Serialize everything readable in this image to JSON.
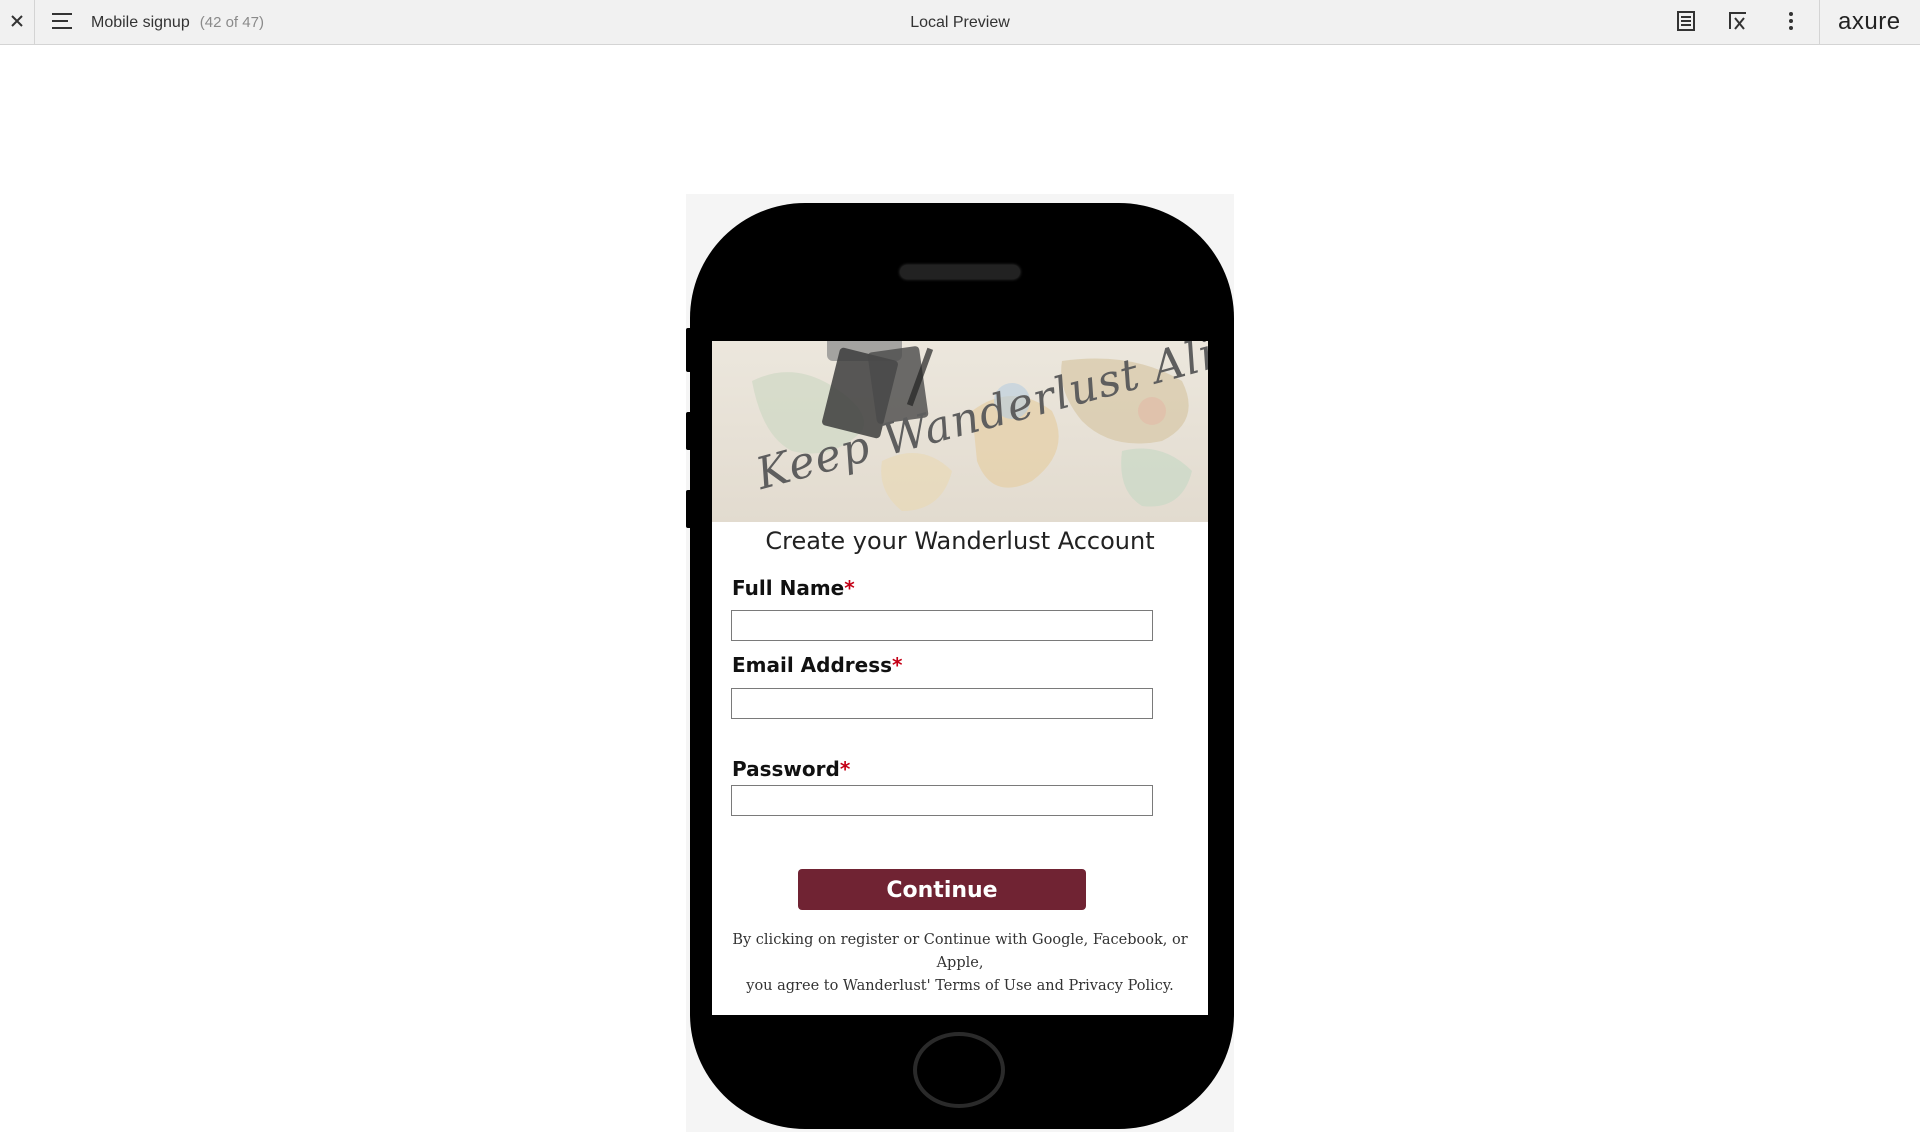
{
  "toolbar": {
    "close_icon": "close-icon",
    "menu_icon": "hamburger-menu-icon",
    "page_name": "Mobile signup",
    "page_count": "(42 of 47)",
    "title": "Local Preview",
    "notes_icon": "notes-icon",
    "inspect_icon": "inspect-icon",
    "more_icon": "more-vertical-icon",
    "logo": "axure"
  },
  "signup": {
    "banner_text": "Keep Wanderlust Alive",
    "title": "Create your Wanderlust Account",
    "fields": [
      {
        "label": "Full Name",
        "required_mark": "*",
        "value": "",
        "placeholder": ""
      },
      {
        "label": "Email Address",
        "required_mark": "*",
        "value": "",
        "placeholder": ""
      },
      {
        "label": "Password",
        "required_mark": "*",
        "value": "",
        "placeholder": ""
      }
    ],
    "continue_label": "Continue",
    "legal_line1": "By clicking on register or Continue with Google, Facebook, or Apple,",
    "legal_line2": "you agree to Wanderlust' Terms of Use and Privacy Policy."
  },
  "colors": {
    "continue_button": "#702333",
    "required_mark": "#c40016",
    "toolbar_bg": "#f1f1f1"
  }
}
